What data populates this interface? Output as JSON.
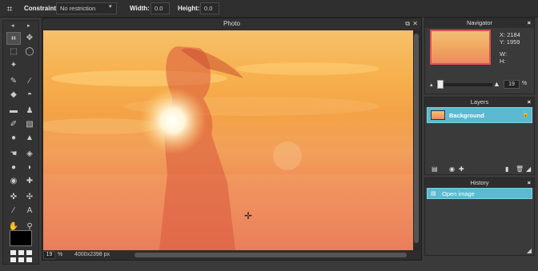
{
  "options_bar": {
    "constraint_label": "Constraint:",
    "constraint_value": "No restriction",
    "constraint_arrow": "▾",
    "width_label": "Width:",
    "width_value": "0.0",
    "height_label": "Height:",
    "height_value": "0.0",
    "tool_icon": "crop-icon"
  },
  "toolbox": {
    "nav_left": "◂",
    "nav_right": "▸",
    "tools": [
      {
        "name": "crop-tool",
        "glyph": "⌗"
      },
      {
        "name": "move-tool",
        "glyph": "✥"
      },
      {
        "name": "marquee-tool",
        "glyph": "⬚"
      },
      {
        "name": "lasso-tool",
        "glyph": "◯"
      },
      {
        "name": "magic-wand-tool",
        "glyph": "✦"
      },
      {
        "name": "pencil-tool",
        "glyph": "✎"
      },
      {
        "name": "brush-tool",
        "glyph": "∕"
      },
      {
        "name": "eraser-tool",
        "glyph": "◆"
      },
      {
        "name": "paint-bucket-tool",
        "glyph": "◓"
      },
      {
        "name": "gradient-tool",
        "glyph": "▬"
      },
      {
        "name": "stamp-tool",
        "glyph": "♟"
      },
      {
        "name": "color-replace-tool",
        "glyph": "✐"
      },
      {
        "name": "draw-tool",
        "glyph": "▧"
      },
      {
        "name": "blur-tool",
        "glyph": "●"
      },
      {
        "name": "sharpen-tool",
        "glyph": "▲"
      },
      {
        "name": "smudge-tool",
        "glyph": "☚"
      },
      {
        "name": "sponge-tool",
        "glyph": "◈"
      },
      {
        "name": "dodge-tool",
        "glyph": "●"
      },
      {
        "name": "burn-tool",
        "glyph": "◗"
      },
      {
        "name": "red-eye-tool",
        "glyph": "◉"
      },
      {
        "name": "spot-heal-tool",
        "glyph": "✚"
      },
      {
        "name": "bloat-tool",
        "glyph": "✜"
      },
      {
        "name": "pinch-tool",
        "glyph": "✣"
      },
      {
        "name": "color-picker-tool",
        "glyph": "∕"
      },
      {
        "name": "type-tool",
        "glyph": "A"
      },
      {
        "name": "hand-tool",
        "glyph": "✋"
      },
      {
        "name": "zoom-tool",
        "glyph": "⚲"
      }
    ]
  },
  "photo": {
    "title": "Photo",
    "zoom": "19",
    "zoom_unit": "%",
    "dimensions": "4000x2398 px"
  },
  "navigator": {
    "title": "Navigator",
    "x_label": "X:",
    "x_value": "2184",
    "y_label": "Y:",
    "y_value": "1959",
    "w_label": "W:",
    "h_label": "H:",
    "zoom": "19",
    "zoom_unit": "%"
  },
  "layers": {
    "title": "Layers",
    "items": [
      {
        "label": "Background"
      }
    ]
  },
  "history": {
    "title": "History",
    "items": [
      {
        "label": "Open image"
      }
    ]
  },
  "colors": {
    "accent": "#5bbad2",
    "panel_bg": "#3a3a3a",
    "foreground_swatch": "#000000"
  }
}
